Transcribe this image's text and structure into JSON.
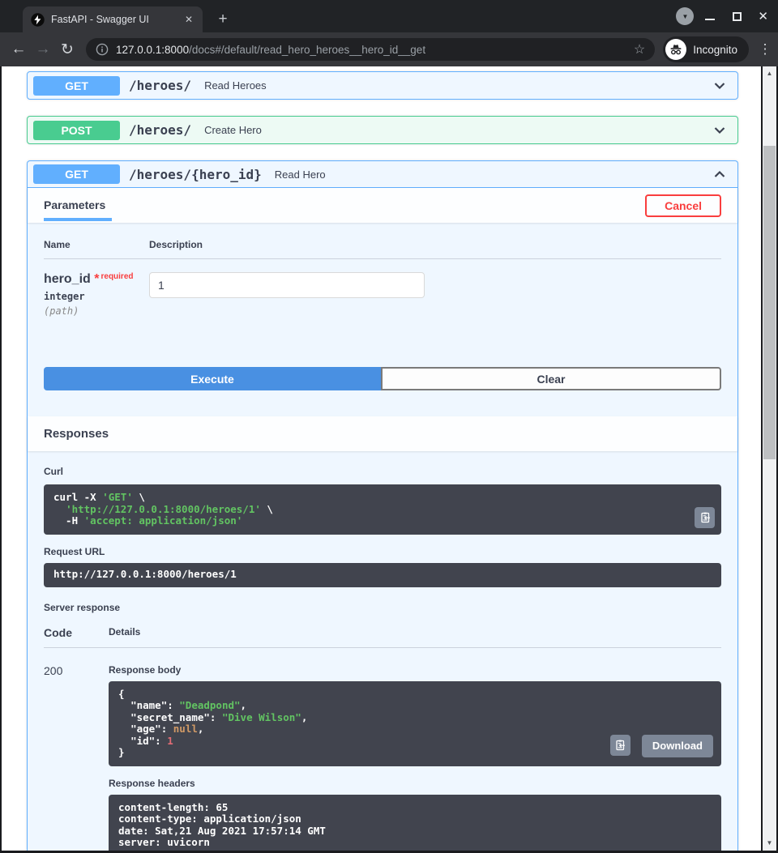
{
  "browser": {
    "tab_title": "FastAPI - Swagger UI",
    "new_tab_label": "+",
    "url_host": "127.0.0.1:8000",
    "url_path": "/docs#/default/read_hero_heroes__hero_id__get",
    "incognito_label": "Incognito"
  },
  "endpoints": {
    "read_heroes": {
      "method": "GET",
      "path": "/heroes/",
      "summary": "Read Heroes"
    },
    "create_hero": {
      "method": "POST",
      "path": "/heroes/",
      "summary": "Create Hero"
    },
    "read_hero": {
      "method": "GET",
      "path": "/heroes/{hero_id}",
      "summary": "Read Hero"
    }
  },
  "operation": {
    "tab_parameters": "Parameters",
    "cancel": "Cancel",
    "columns": {
      "name": "Name",
      "description": "Description"
    },
    "parameter": {
      "name": "hero_id",
      "required_mark": "*",
      "required": "required",
      "type": "integer",
      "location": "(path)",
      "value": "1"
    },
    "execute": "Execute",
    "clear": "Clear",
    "responses_title": "Responses",
    "curl_label": "Curl",
    "request_url_label": "Request URL",
    "request_url": "http://127.0.0.1:8000/heroes/1",
    "server_response_label": "Server response",
    "code_col": "Code",
    "details_col": "Details",
    "status_code": "200",
    "response_body_label": "Response body",
    "download": "Download",
    "response_headers_label": "Response headers",
    "response_headers": "content-length: 65 \ncontent-type: application/json \ndate: Sat,21 Aug 2021 17:57:14 GMT \nserver: uvicorn "
  },
  "curl_tokens": [
    {
      "c": "p",
      "t": "curl -X "
    },
    {
      "c": "s",
      "t": "'GET'"
    },
    {
      "c": "p",
      "t": " \\\n  "
    },
    {
      "c": "s",
      "t": "'http://127.0.0.1:8000/heroes/1'"
    },
    {
      "c": "p",
      "t": " \\\n  -H "
    },
    {
      "c": "s",
      "t": "'accept: application/json'"
    }
  ],
  "body_tokens": [
    {
      "c": "p",
      "t": "{\n  "
    },
    {
      "c": "k",
      "t": "\"name\""
    },
    {
      "c": "p",
      "t": ": "
    },
    {
      "c": "s",
      "t": "\"Deadpond\""
    },
    {
      "c": "p",
      "t": ",\n  "
    },
    {
      "c": "k",
      "t": "\"secret_name\""
    },
    {
      "c": "p",
      "t": ": "
    },
    {
      "c": "s",
      "t": "\"Dive Wilson\""
    },
    {
      "c": "p",
      "t": ",\n  "
    },
    {
      "c": "k",
      "t": "\"age\""
    },
    {
      "c": "p",
      "t": ": "
    },
    {
      "c": "n",
      "t": "null"
    },
    {
      "c": "p",
      "t": ",\n  "
    },
    {
      "c": "k",
      "t": "\"id\""
    },
    {
      "c": "p",
      "t": ": "
    },
    {
      "c": "num",
      "t": "1"
    },
    {
      "c": "p",
      "t": "\n}"
    }
  ],
  "colors": {
    "get_blue": "#61affe",
    "post_green": "#49cc90",
    "execute_blue": "#4990e2",
    "cancel_red": "#f93e3e",
    "code_bg": "#41444e",
    "string_green": "#62c462",
    "null_orange": "#d19a66",
    "number_red": "#e06c75"
  }
}
